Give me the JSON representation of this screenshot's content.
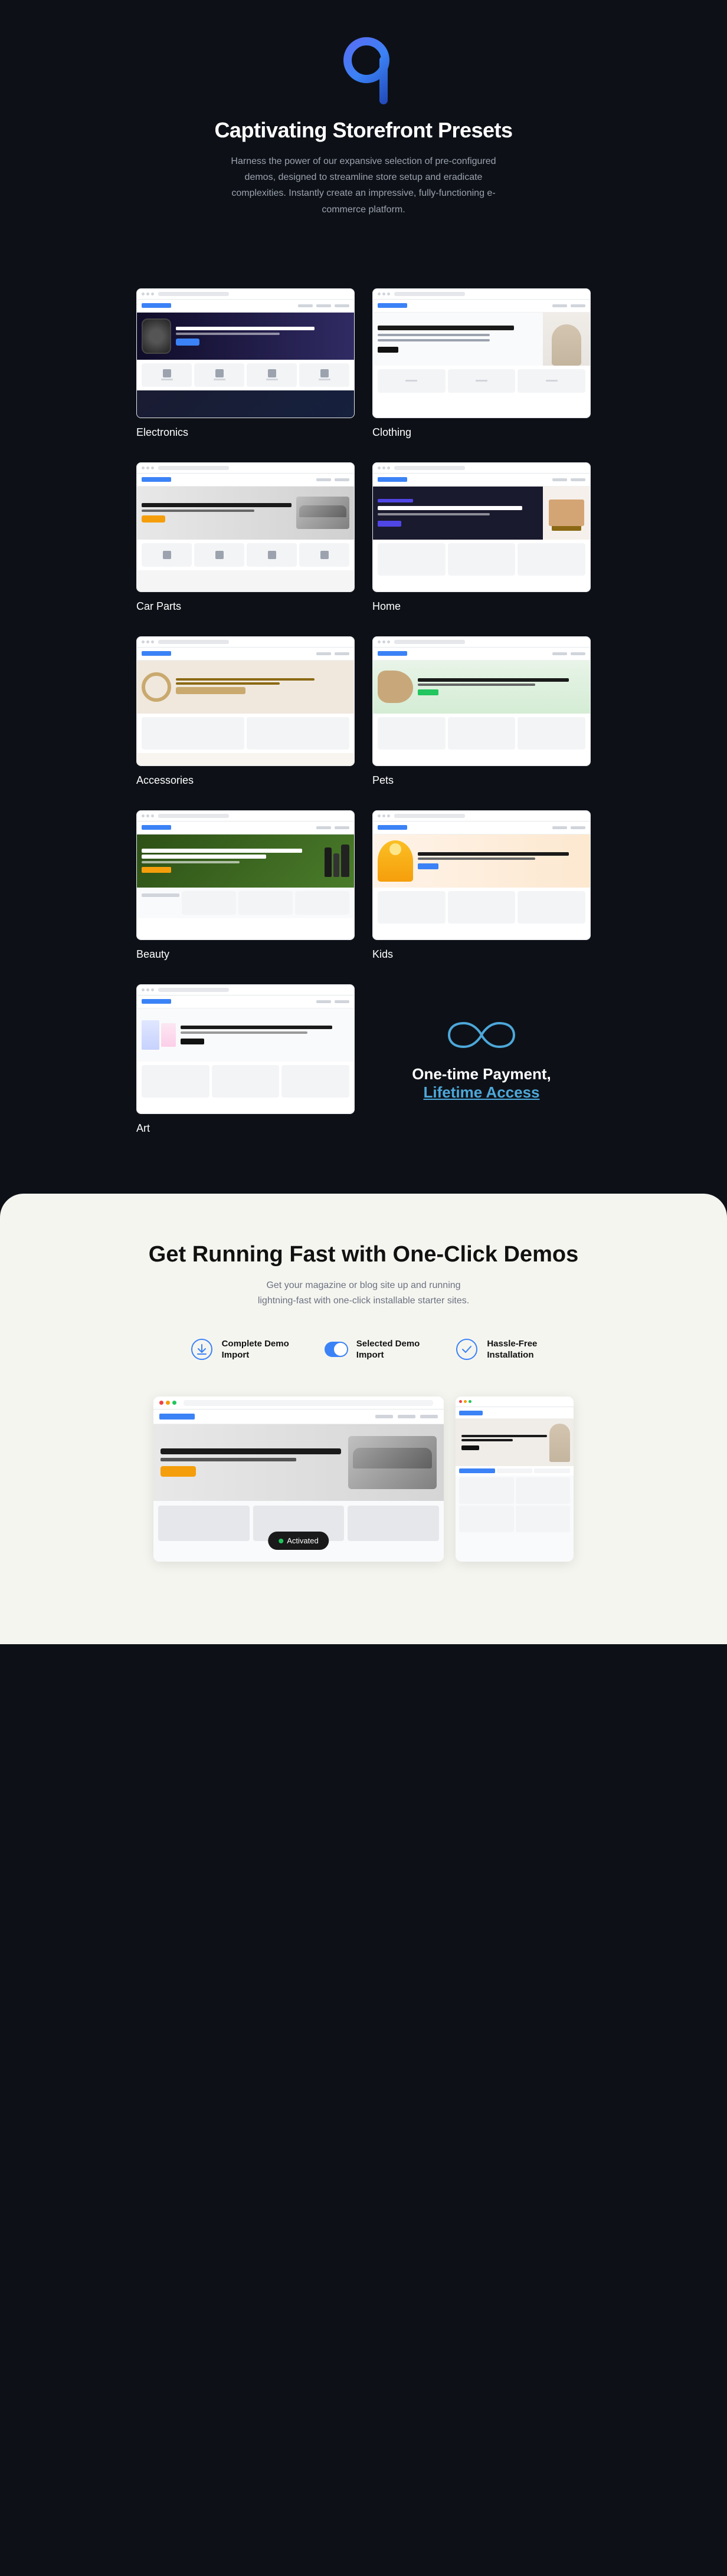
{
  "hero": {
    "number": "9",
    "title": "Captivating Storefront Presets",
    "description": "Harness the power of our expansive selection of pre-configured demos, designed to streamline store setup and eradicate complexities. Instantly create an impressive, fully-functioning e-commerce platform."
  },
  "demos": [
    {
      "label": "Electronics",
      "position": "left"
    },
    {
      "label": "Clothing",
      "position": "right"
    },
    {
      "label": "Car Parts",
      "position": "left"
    },
    {
      "label": "Home",
      "position": "right"
    },
    {
      "label": "Accessories",
      "position": "left"
    },
    {
      "label": "Pets",
      "position": "right"
    },
    {
      "label": "Beauty",
      "position": "left"
    },
    {
      "label": "Kids",
      "position": "right"
    },
    {
      "label": "Art",
      "position": "left"
    }
  ],
  "infinity": {
    "symbol": "∞",
    "line1": "One-time Payment,",
    "line2": "Lifetime Access"
  },
  "oneclickSection": {
    "title": "Get Running Fast with One-Click Demos",
    "description": "Get your magazine or blog site up and running lightning-fast with one-click installable starter sites."
  },
  "features": [
    {
      "icon": "download",
      "label": "Complete Demo\nImport"
    },
    {
      "icon": "toggle",
      "label": "Selected Demo\nImport"
    },
    {
      "icon": "checkmark",
      "label": "Hassle-Free\nInstallation"
    }
  ],
  "activatedBadge": "Activated"
}
